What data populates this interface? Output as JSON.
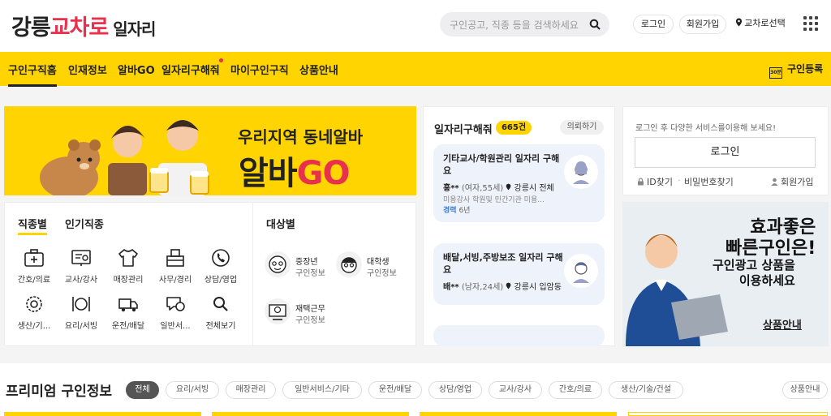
{
  "header": {
    "logo": {
      "part1": "강릉",
      "part2": "교차로",
      "part3": "일자리"
    },
    "search_placeholder": "구인공고, 직종 등을 검색하세요",
    "login": "로그인",
    "signup": "회원가입",
    "region": "교차로선택"
  },
  "nav": {
    "items": [
      "구인구직홈",
      "인재정보",
      "알바GO",
      "일자리구해줘",
      "마이구인구직",
      "상품안내"
    ],
    "register": "구인등록",
    "register_icon": "30분"
  },
  "banner": {
    "line1": "우리지역 동네알바",
    "line2_a": "알바",
    "line2_b": "GO"
  },
  "categories": {
    "tab_by_type": "직종별",
    "tab_popular": "인기직종",
    "items": [
      "간호/의료",
      "교사/강사",
      "매장관리",
      "사무/경리",
      "상담/영업",
      "생산/기...",
      "요리/서빙",
      "운전/배달",
      "일반서...",
      "전체보기"
    ],
    "target_title": "대상별",
    "targets": [
      {
        "line1": "중장년",
        "line2": "구인정보"
      },
      {
        "line1": "대학생",
        "line2": "구인정보"
      },
      {
        "line1": "재택근무",
        "line2": "구인정보"
      }
    ]
  },
  "job_request": {
    "title": "일자리구해줘",
    "count": "665건",
    "request_button": "의뢰하기",
    "seekers": [
      {
        "title": "기타교사/학원관리 일자리 구해요",
        "name": "홍**",
        "info": "(여자,55세)",
        "location": "강릉시 전체",
        "desc": "미용강사 학원및 민간기관 미용...",
        "exp_label": "경력",
        "exp_value": "6년"
      },
      {
        "title": "배달,서빙,주방보조 일자리 구해요",
        "name": "배**",
        "info": "(남자,24세)",
        "location": "강릉시 입암동"
      }
    ]
  },
  "login_box": {
    "message": "로그인 후 다양한 서비스를이용해 보세요!",
    "button": "로그인",
    "find_id": "ID찾기",
    "find_pw": "비밀번호찾기",
    "signup": "회원가입"
  },
  "ad": {
    "line1": "효과좋은",
    "line2": "빠른구인은!",
    "line3": "구인광고 상품을",
    "line4": "이용하세요",
    "link": "상품안내"
  },
  "premium": {
    "title": "프리미엄 구인정보",
    "chips": [
      "전체",
      "요리/서빙",
      "매장관리",
      "일반서비스/기타",
      "운전/배달",
      "상담/영업",
      "교사/강사",
      "간호/의료",
      "생산/기술/건설"
    ],
    "product_button": "상품안내"
  },
  "colors": {
    "brand_yellow": "#ffd400",
    "brand_red": "#e8324d",
    "link_blue": "#3a7bd5"
  }
}
